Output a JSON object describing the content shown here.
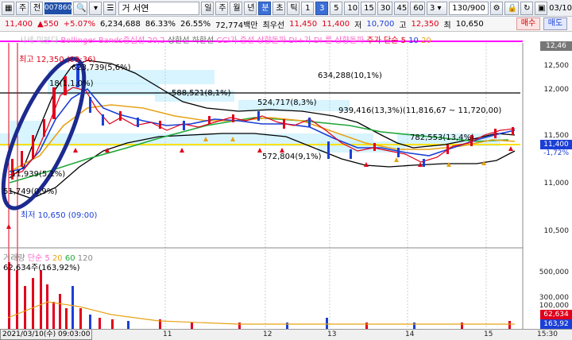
{
  "toolbar": {
    "buttons_left": [
      "주",
      "전"
    ],
    "code": "007860",
    "dropdown": "",
    "btn1": "0",
    "name": "서연",
    "periods": [
      "일",
      "주",
      "월",
      "년",
      "분",
      "초",
      "틱"
    ],
    "active_period": "분",
    "intervals": [
      "1",
      "3",
      "5",
      "10",
      "15",
      "30",
      "45",
      "60"
    ],
    "active_interval": "3",
    "interval_select": "3",
    "count": "130/900",
    "date_right": "03/10"
  },
  "quote": {
    "price": "11,400",
    "change": "550",
    "change_pct": "+5.07%",
    "volume": "6,234,688",
    "rate1": "86.33%",
    "rate2": "26.55%",
    "amount": "72,774백만",
    "best_ask_label": "최우선",
    "best_ask": "11,450",
    "best_bid": "11,400",
    "low_label": "저",
    "low": "10,700",
    "high_label": "고",
    "high": "12,350",
    "prev_label": "최",
    "prev": "10,650",
    "buy": "매수",
    "sell": "매도"
  },
  "legend": {
    "items": [
      "시세 미분다",
      "Bollinger Bands중심선 20,2",
      "상한선",
      "하한선",
      "CCI가 중선 상향돌파",
      "DI+가 DI-를 상향돌파",
      "주가 단순 5",
      "10",
      "20"
    ]
  },
  "annotations": {
    "high": "최고 12,350 (09:36)",
    "low": "최저 10,650 (09:00)",
    "a1": "634,288(10,1%)",
    "a2": "588,521(8,1%)",
    "a3": "524,717(8,3%)",
    "a4": "939,416(13,3%)(11,816,67 ~ 11,720,00)",
    "a5": "572,804(9,1%)",
    "a6": "782,553(13,4%)",
    "a7": "623,739(5,6%)",
    "a8": "18(1,1,0%)",
    "a9": "11,939(5,1%)",
    "a10": "51,749(0,9%)"
  },
  "price_axis": [
    "12,500",
    "12,000",
    "11,500",
    "11,000",
    "10,500"
  ],
  "price_tags": {
    "top": "12,46",
    "current": "11,400",
    "pct": "-1,72%"
  },
  "volume": {
    "title": "거래량",
    "ma_label": "단순 5",
    "ma2": "20",
    "ma3": "60",
    "ma4": "120",
    "current": "62,634주(163,92%)",
    "axis": [
      "500,000",
      "300,000",
      "100,000"
    ],
    "tag1": "62,634",
    "tag2": "163,92"
  },
  "xaxis": {
    "date_box": "2021/03/10(수) 09:03:00",
    "labels": [
      "11",
      "12",
      "13",
      "14",
      "15"
    ],
    "right": "15:30"
  },
  "colors": {
    "bb": "#000000",
    "ma5": "#e0001b",
    "ma10": "#1b3fd6",
    "ma20": "#e8a317",
    "ma60": "#1fa83a",
    "yellow_line": "#ffe000",
    "highlight": "#c6f0ff"
  }
}
